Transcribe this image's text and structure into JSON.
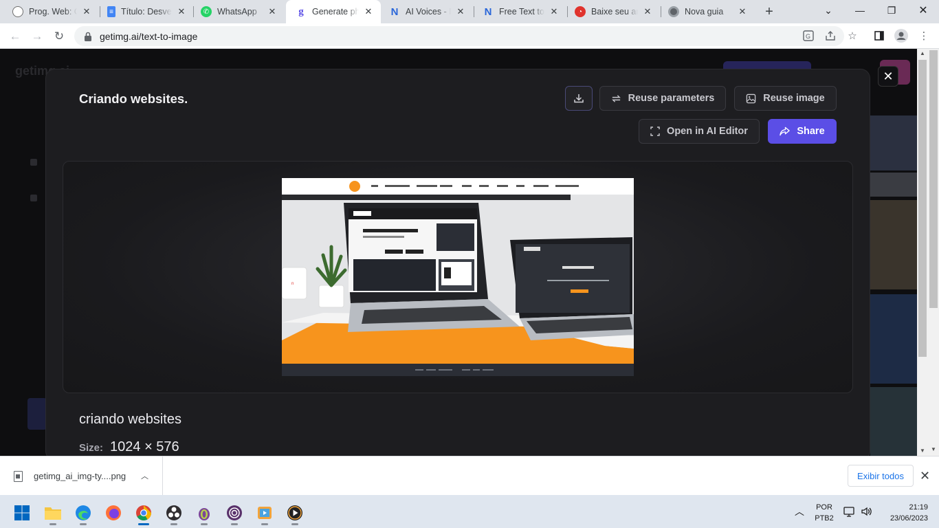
{
  "browser": {
    "tabs": [
      {
        "title": "Prog. Web: Cr",
        "favicon_color": "#8c8c8c",
        "favicon": "openai-icon"
      },
      {
        "title": "Título: Desve",
        "favicon_color": "#4285f4",
        "favicon": "docs-icon"
      },
      {
        "title": "WhatsApp",
        "favicon_color": "#25d366",
        "favicon": "whatsapp-icon"
      },
      {
        "title": "Generate pho",
        "favicon_color": "#5b4ee6",
        "favicon": "getimg-icon",
        "active": true
      },
      {
        "title": "AI Voices - Na",
        "favicon_color": "#2a66d9",
        "favicon": "n-icon"
      },
      {
        "title": "Free Text to S",
        "favicon_color": "#2a66d9",
        "favicon": "n-icon"
      },
      {
        "title": "Baixe seu arq",
        "favicon_color": "#e0332d",
        "favicon": "red-circle-icon"
      },
      {
        "title": "Nova guia",
        "favicon_color": "#5f6368",
        "favicon": "chrome-icon"
      }
    ],
    "url": "getimg.ai/text-to-image"
  },
  "background": {
    "logo": "getimg.ai"
  },
  "modal": {
    "title": "Criando websites.",
    "buttons": {
      "reuse_parameters": "Reuse parameters",
      "reuse_image": "Reuse image",
      "open_editor": "Open in AI Editor",
      "share": "Share"
    },
    "prompt": "criando websites",
    "size_label": "Size:",
    "size_value": "1024 × 576"
  },
  "download_bar": {
    "file_name": "getimg_ai_img-ty....png",
    "show_all": "Exibir todos"
  },
  "taskbar": {
    "language": "POR",
    "keyboard": "PTB2",
    "time": "21:19",
    "date": "23/06/2023"
  },
  "colors": {
    "accent": "#5b4ee6",
    "image_orange": "#f7941d"
  }
}
